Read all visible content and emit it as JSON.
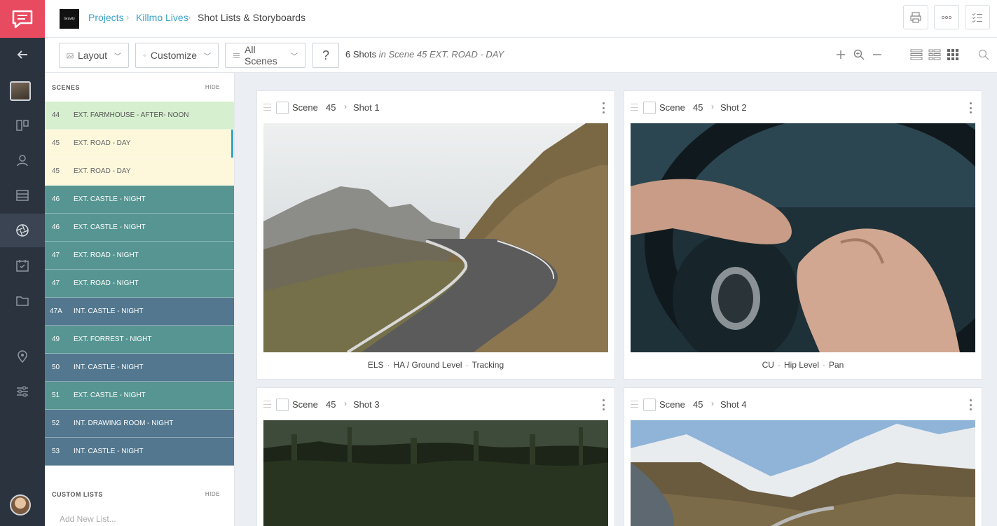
{
  "rail": {
    "icons": [
      "chat-logo-icon",
      "back-arrow-icon",
      "project-thumbnail",
      "board-icon",
      "contacts-icon",
      "table-icon",
      "aperture-icon",
      "calendar-icon",
      "folder-icon",
      "location-pin-icon",
      "sliders-icon",
      "user-avatar"
    ]
  },
  "header": {
    "project_logo_text": "Gravity",
    "breadcrumbs": [
      "Projects",
      "Killmo Lives",
      "Shot Lists & Storyboards"
    ],
    "actions": [
      "print-icon",
      "more-icon",
      "checklist-icon"
    ]
  },
  "toolbar": {
    "layout_label": "Layout",
    "customize_label": "Customize",
    "scenes_label": "All Scenes",
    "help_label": "?",
    "shot_count": "6 Shots",
    "shot_scope": "in Scene 45 EXT. ROAD - DAY"
  },
  "scenes_panel": {
    "title": "SCENES",
    "hide_label": "HIDE",
    "items": [
      {
        "num": "44",
        "name": "EXT. FARMHOUSE - AFTER- NOON",
        "color": "#d6f0cf",
        "text_color": "#555555"
      },
      {
        "num": "45",
        "name": "EXT. ROAD - DAY",
        "color": "#fdf8dc",
        "text_color": "#666666"
      },
      {
        "num": "45",
        "name": "EXT. ROAD - DAY",
        "color": "#fdf8dc",
        "text_color": "#666666"
      },
      {
        "num": "46",
        "name": "EXT. CASTLE - NIGHT",
        "color": "#569592",
        "text_color": "#ffffff"
      },
      {
        "num": "46",
        "name": "EXT. CASTLE - NIGHT",
        "color": "#569592",
        "text_color": "#ffffff"
      },
      {
        "num": "47",
        "name": "EXT. ROAD - NIGHT",
        "color": "#569592",
        "text_color": "#ffffff"
      },
      {
        "num": "47",
        "name": "EXT. ROAD - NIGHT",
        "color": "#569592",
        "text_color": "#ffffff"
      },
      {
        "num": "47A",
        "name": "INT. CASTLE - NIGHT",
        "color": "#52778e",
        "text_color": "#ffffff"
      },
      {
        "num": "49",
        "name": "EXT. FORREST - NIGHT",
        "color": "#569592",
        "text_color": "#ffffff"
      },
      {
        "num": "50",
        "name": "INT. CASTLE - NIGHT",
        "color": "#52778e",
        "text_color": "#ffffff"
      },
      {
        "num": "51",
        "name": "EXT. CASTLE - NIGHT",
        "color": "#569592",
        "text_color": "#ffffff"
      },
      {
        "num": "52",
        "name": "INT. DRAWING ROOM - NIGHT",
        "color": "#52778e",
        "text_color": "#ffffff"
      },
      {
        "num": "53",
        "name": "INT. CASTLE - NIGHT",
        "color": "#52778e",
        "text_color": "#ffffff"
      }
    ],
    "custom_lists_title": "CUSTOM LISTS",
    "custom_lists_hide": "HIDE",
    "add_list_placeholder": "Add New List..."
  },
  "shots": [
    {
      "scene_label": "Scene",
      "scene_num": "45",
      "shot": "Shot 1",
      "size": "ELS",
      "angle": "HA / Ground Level",
      "movement": "Tracking"
    },
    {
      "scene_label": "Scene",
      "scene_num": "45",
      "shot": "Shot 2",
      "size": "CU",
      "angle": "Hip Level",
      "movement": "Pan"
    },
    {
      "scene_label": "Scene",
      "scene_num": "45",
      "shot": "Shot 3",
      "size": "",
      "angle": "",
      "movement": ""
    },
    {
      "scene_label": "Scene",
      "scene_num": "45",
      "shot": "Shot 4",
      "size": "",
      "angle": "",
      "movement": ""
    }
  ],
  "colors": {
    "brand": "#e84a5f",
    "rail": "#2b333e",
    "link": "#3aa0c8"
  }
}
